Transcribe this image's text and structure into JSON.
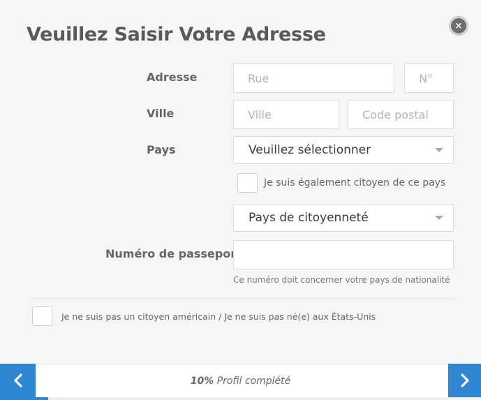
{
  "title": "Veuillez Saisir Votre Adresse",
  "close_icon": "×",
  "labels": {
    "address": "Adresse",
    "city": "Ville",
    "country": "Pays",
    "passport": "Numéro de passeport"
  },
  "fields": {
    "street_placeholder": "Rue",
    "number_placeholder": "N°",
    "city_placeholder": "Ville",
    "postal_placeholder": "Code postal",
    "passport_placeholder": ""
  },
  "country_select": {
    "value": "Veuillez sélectionner"
  },
  "citizenship_select": {
    "value": "Pays de citoyenneté"
  },
  "citizen_checkbox_label": "Je suis également citoyen de ce pays",
  "passport_hint": "Ce numéro doit concerner votre pays de nationalité",
  "us_checkbox_label": "Je ne suis pas un citoyen américain / Je ne suis pas né(e) aux États-Unis",
  "progress": {
    "percent_label": "10%",
    "suffix": " Profil complété",
    "fraction": 0.1
  },
  "icons": {
    "prev": "chevron-left-icon",
    "next": "chevron-right-icon",
    "close": "close-icon"
  },
  "colors": {
    "accent": "#2f86d1"
  }
}
